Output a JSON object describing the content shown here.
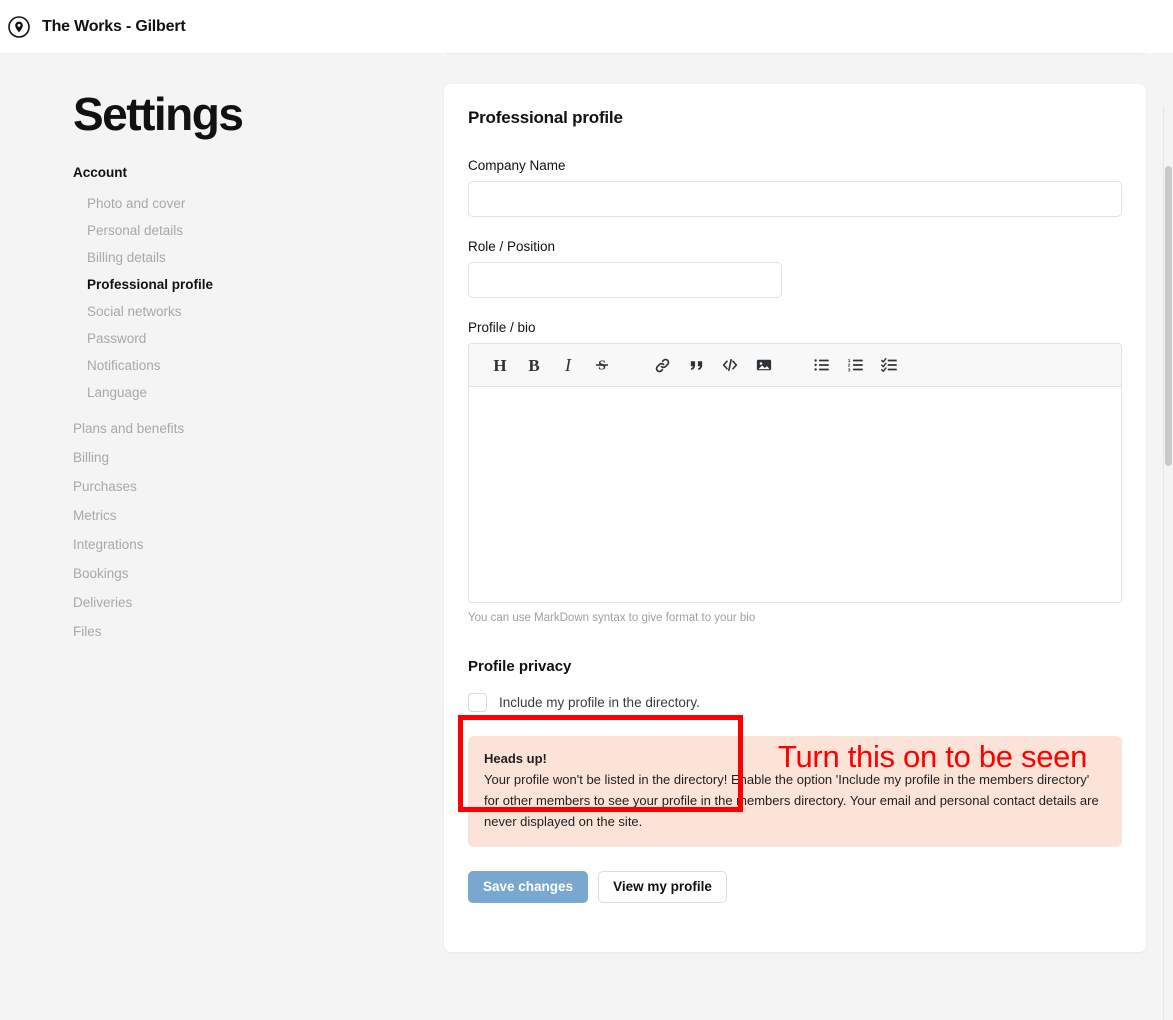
{
  "header": {
    "brand_icon": "location-pin-icon",
    "brand_name": "The Works - Gilbert"
  },
  "sidebar": {
    "title": "Settings",
    "account_group_label": "Account",
    "account_items": [
      {
        "label": "Photo and cover",
        "active": false
      },
      {
        "label": "Personal details",
        "active": false
      },
      {
        "label": "Billing details",
        "active": false
      },
      {
        "label": "Professional profile",
        "active": true
      },
      {
        "label": "Social networks",
        "active": false
      },
      {
        "label": "Password",
        "active": false
      },
      {
        "label": "Notifications",
        "active": false
      },
      {
        "label": "Language",
        "active": false
      }
    ],
    "root_items": [
      {
        "label": "Plans and benefits"
      },
      {
        "label": "Billing"
      },
      {
        "label": "Purchases"
      },
      {
        "label": "Metrics"
      },
      {
        "label": "Integrations"
      },
      {
        "label": "Bookings"
      },
      {
        "label": "Deliveries"
      },
      {
        "label": "Files"
      }
    ]
  },
  "main": {
    "card_title": "Professional profile",
    "company": {
      "label": "Company Name",
      "value": "",
      "placeholder": ""
    },
    "role": {
      "label": "Role / Position",
      "value": "",
      "placeholder": ""
    },
    "bio": {
      "label": "Profile / bio",
      "value": "",
      "placeholder": "",
      "hint": "You can use MarkDown syntax to give format to your bio",
      "toolbar": [
        {
          "name": "heading-icon",
          "glyph": "H"
        },
        {
          "name": "bold-icon",
          "glyph": "B"
        },
        {
          "name": "italic-icon",
          "glyph": "I"
        },
        {
          "name": "strikethrough-icon",
          "glyph": "S"
        },
        {
          "name": "link-icon",
          "glyph": ""
        },
        {
          "name": "quote-icon",
          "glyph": ""
        },
        {
          "name": "code-icon",
          "glyph": "</>"
        },
        {
          "name": "image-icon",
          "glyph": ""
        },
        {
          "name": "bullet-list-icon",
          "glyph": ""
        },
        {
          "name": "numbered-list-icon",
          "glyph": ""
        },
        {
          "name": "checklist-icon",
          "glyph": ""
        }
      ]
    },
    "privacy": {
      "title": "Profile privacy",
      "checkbox_label": "Include my profile in the directory.",
      "checked": false
    },
    "alert": {
      "title": "Heads up!",
      "body": "Your profile won't be listed in the directory! Enable the option 'Include my profile in the members directory' for other members to see your profile in the members directory. Your email and personal contact details are never displayed on the site.",
      "background_color": "#fce3d8"
    },
    "buttons": {
      "save_label": "Save changes",
      "view_label": "View my profile",
      "save_color": "#7aa7d0"
    }
  },
  "annotations": {
    "highlight_color": "#ff0000",
    "callout_text": "Turn this on to be seen"
  }
}
